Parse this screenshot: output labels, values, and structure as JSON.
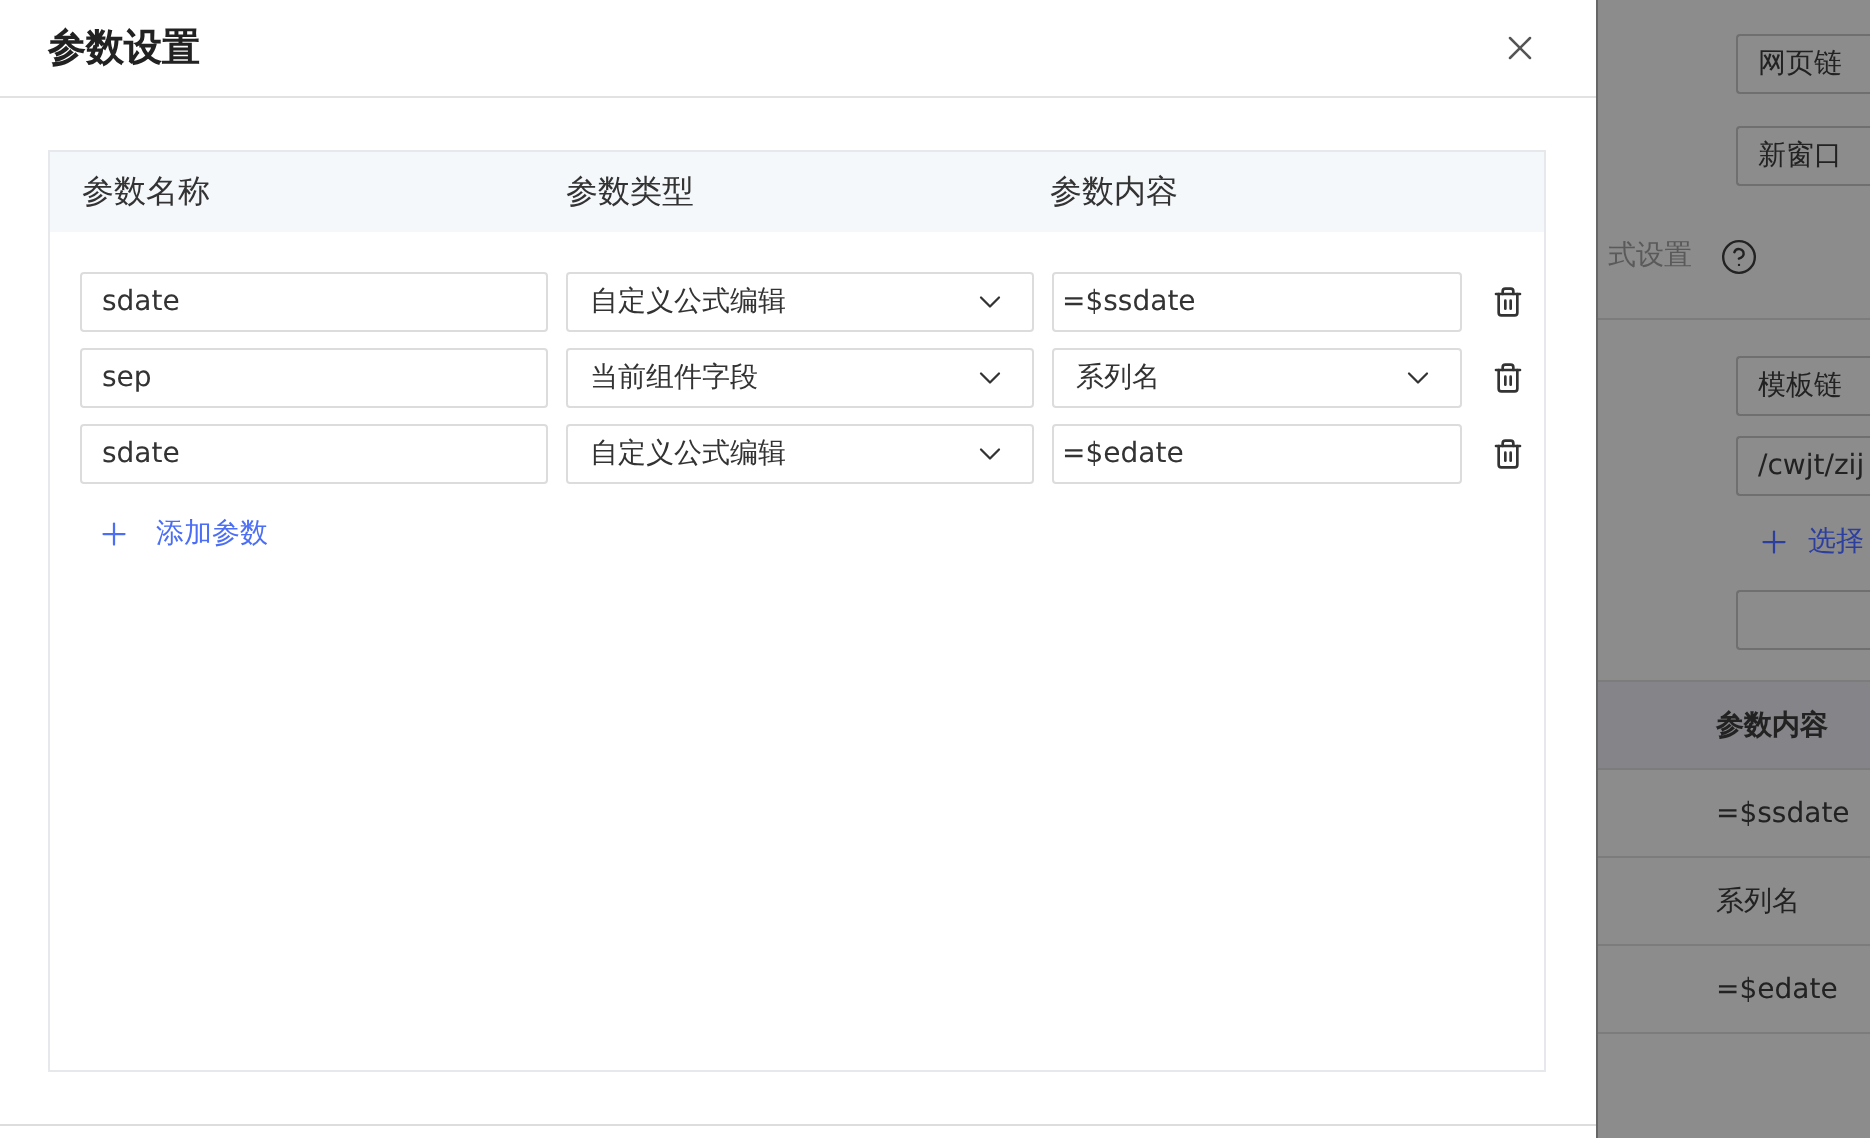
{
  "dialog": {
    "title": "参数设置",
    "columns": [
      "参数名称",
      "参数类型",
      "参数内容"
    ],
    "rows": [
      {
        "name": "sdate",
        "type": "自定义公式编辑",
        "content": "=$ssdate",
        "kind": "input"
      },
      {
        "name": "sep",
        "type": "当前组件字段",
        "content": "系列名",
        "kind": "select"
      },
      {
        "name": "sdate",
        "type": "自定义公式编辑",
        "content": "=$edate",
        "kind": "input"
      }
    ],
    "add_button": "添加参数"
  },
  "background_panel": {
    "link_type": "网页链",
    "open_mode": "新窗口",
    "section_label": "式设置",
    "template_link": "模板链",
    "template_path": "/cwjt/zij",
    "select_button": "选择",
    "table": {
      "column": "参数内容",
      "rows": [
        "=$ssdate",
        "系列名",
        "=$edate"
      ]
    }
  }
}
